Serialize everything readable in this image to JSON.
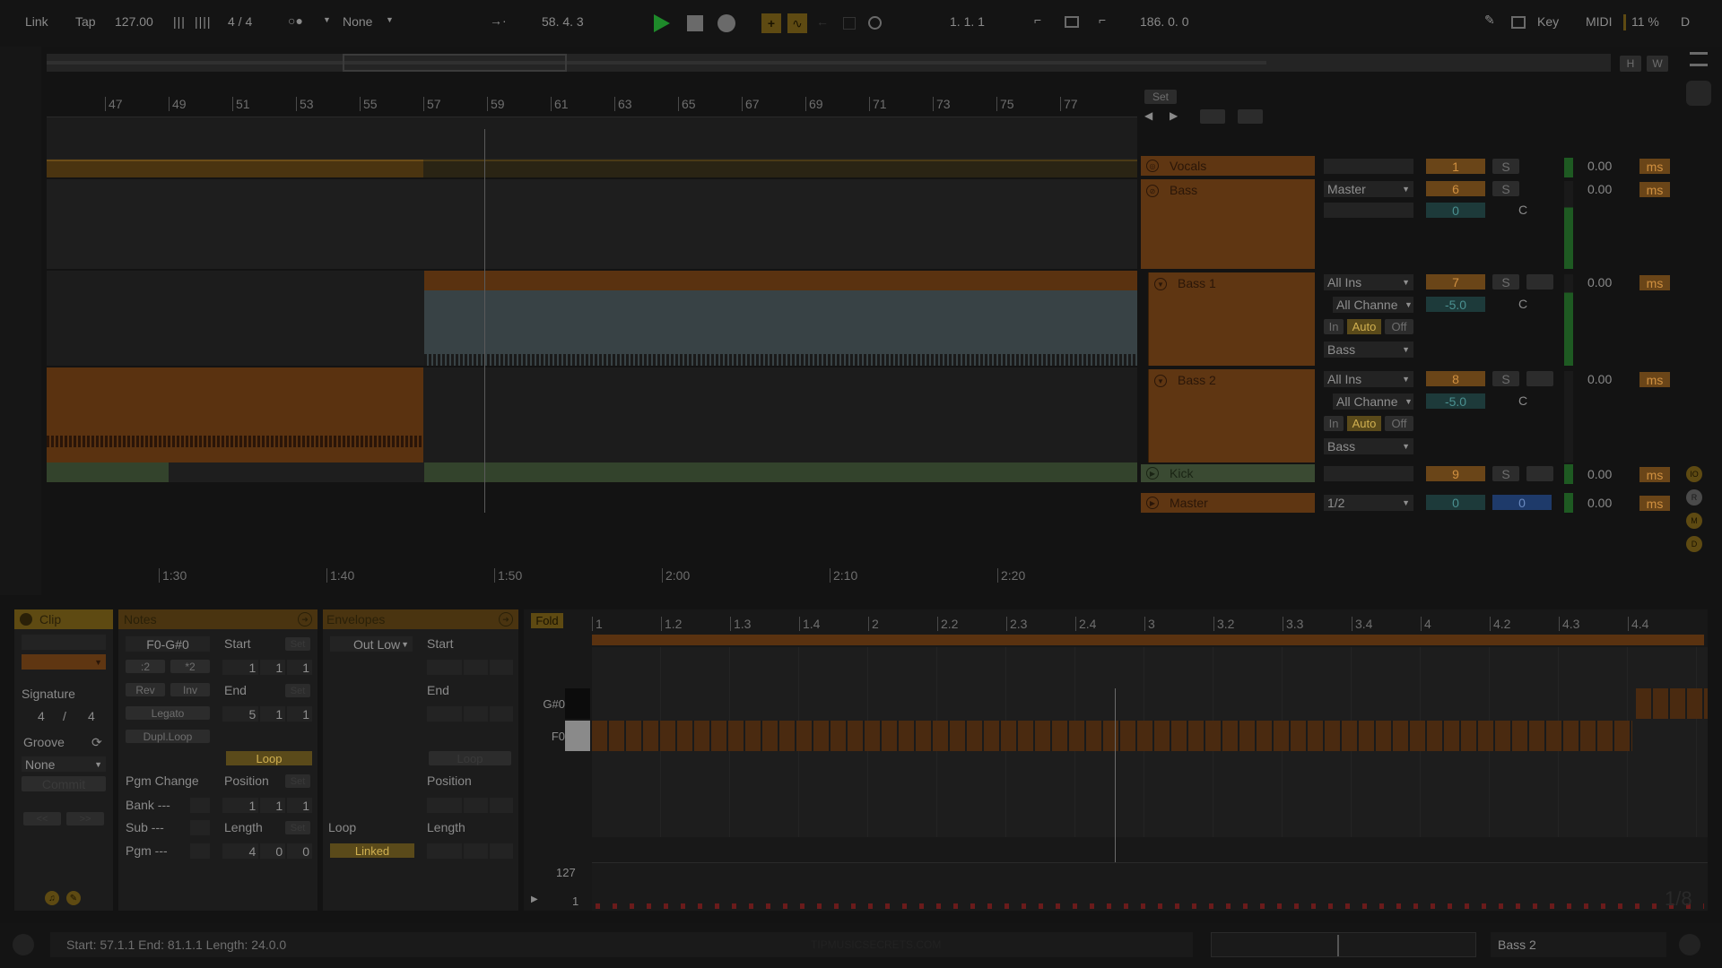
{
  "transport": {
    "link": "Link",
    "tap": "Tap",
    "tempo": "127.00",
    "time_sig": "4 / 4",
    "quantize": "None",
    "position": "58.  4.  3",
    "loop_start": "1.  1.  1",
    "loop_length": "186.  0.  0",
    "key_label": "Key",
    "midi_label": "MIDI",
    "cpu": "11 %",
    "disk": "D"
  },
  "overview": {
    "h": "H",
    "w": "W"
  },
  "bar_ruler": [
    "47",
    "49",
    "51",
    "53",
    "55",
    "57",
    "59",
    "61",
    "63",
    "65",
    "67",
    "69",
    "71",
    "73",
    "75",
    "77"
  ],
  "time_ruler": [
    "1:30",
    "1:40",
    "1:50",
    "2:00",
    "2:10",
    "2:20"
  ],
  "set_label": "Set",
  "tracks": [
    {
      "name": "Vocals",
      "input": "",
      "number": "1",
      "solo": "S",
      "volume": "0.00",
      "delay_unit": "ms"
    },
    {
      "name": "Bass",
      "output": "Master",
      "number": "6",
      "solo": "S",
      "volume": "0.00",
      "delay_unit": "ms",
      "pan_val": "0",
      "pan": "C"
    },
    {
      "name": "Bass 1",
      "input": "All Ins",
      "channel": "All Channe",
      "monitor": [
        "In",
        "Auto",
        "Off"
      ],
      "output": "Bass",
      "number": "7",
      "solo": "S",
      "volume": "0.00",
      "delay_unit": "ms",
      "vol_val": "-5.0",
      "pan": "C"
    },
    {
      "name": "Bass 2",
      "input": "All Ins",
      "channel": "All Channe",
      "monitor": [
        "In",
        "Auto",
        "Off"
      ],
      "output": "Bass",
      "number": "8",
      "solo": "S",
      "volume": "0.00",
      "delay_unit": "ms",
      "vol_val": "-5.0",
      "pan": "C"
    },
    {
      "name": "Kick",
      "number": "9",
      "solo": "S",
      "volume": "0.00",
      "delay_unit": "ms"
    },
    {
      "name": "Master",
      "output": "1/2",
      "number": "0",
      "cue": "0",
      "volume": "0.00",
      "delay_unit": "ms"
    }
  ],
  "right_edge_buttons": [
    "IO",
    "R",
    "M",
    "D"
  ],
  "clip_panel": {
    "title": "Clip",
    "signature_label": "Signature",
    "sig_num": "4",
    "sig_sep": "/",
    "sig_den": "4",
    "groove_label": "Groove",
    "groove_value": "None",
    "commit": "Commit",
    "nav_prev": "<<",
    "nav_next": ">>"
  },
  "notes_panel": {
    "title": "Notes",
    "range": "F0-G#0",
    "half": ":2",
    "double": "*2",
    "rev": "Rev",
    "inv": "Inv",
    "legato": "Legato",
    "dupl_loop": "Dupl.Loop",
    "start_label": "Start",
    "start": [
      "1",
      "1",
      "1"
    ],
    "set": "Set",
    "end_label": "End",
    "end": [
      "5",
      "1",
      "1"
    ],
    "loop": "Loop",
    "pgm_change": "Pgm Change",
    "bank": "Bank ---",
    "sub": "Sub ---",
    "pgm": "Pgm ---",
    "position_label": "Position",
    "position": [
      "1",
      "1",
      "1"
    ],
    "length_label": "Length",
    "length": [
      "4",
      "0",
      "0"
    ]
  },
  "envelopes_panel": {
    "title": "Envelopes",
    "source": "Out Low",
    "start_label": "Start",
    "end_label": "End",
    "loop": "Loop",
    "position_label": "Position",
    "loop_label": "Loop",
    "linked": "Linked",
    "length_label": "Length"
  },
  "midi_editor": {
    "fold": "Fold",
    "ruler": [
      "1",
      "1.2",
      "1.3",
      "1.4",
      "2",
      "2.2",
      "2.3",
      "2.4",
      "3",
      "3.2",
      "3.3",
      "3.4",
      "4",
      "4.2",
      "4.3",
      "4.4"
    ],
    "keys": [
      "G#0",
      "F0"
    ],
    "velocity_max": "127",
    "velocity_min": "1",
    "grid": "1/8"
  },
  "status": {
    "text": "Start: 57.1.1  End: 81.1.1  Length: 24.0.0",
    "watermark": "TIPMUSICSECRETS.COM",
    "track": "Bass 2"
  }
}
